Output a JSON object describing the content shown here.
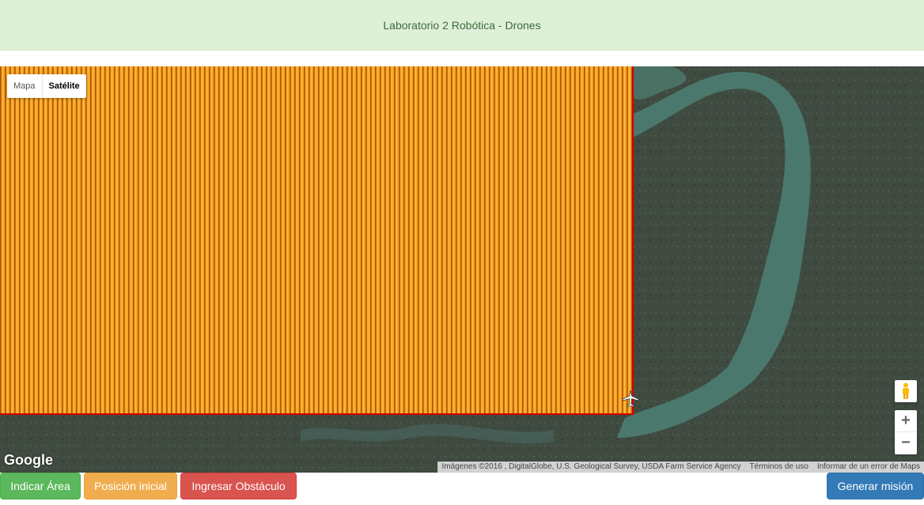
{
  "header": {
    "title": "Laboratorio 2 Robótica - Drones"
  },
  "map": {
    "type_controls": {
      "map_label": "Mapa",
      "satellite_label": "Satélite",
      "selected": "Satélite"
    },
    "logo_text": "Google",
    "zoom_in_label": "+",
    "zoom_out_label": "−",
    "attribution": {
      "imagery": "Imágenes ©2016 , DigitalGlobe, U.S. Geological Survey, USDA Farm Service Agency",
      "terms": "Términos de uso",
      "report": "Informar de un error de Maps"
    },
    "colors": {
      "path_fill": "#f5a623",
      "path_line": "#d40000"
    }
  },
  "buttons": {
    "indicate_area": "Indicar Área",
    "initial_position": "Posición inicial",
    "add_obstacle": "Ingresar Obstáculo",
    "generate_mission": "Generar misión"
  }
}
